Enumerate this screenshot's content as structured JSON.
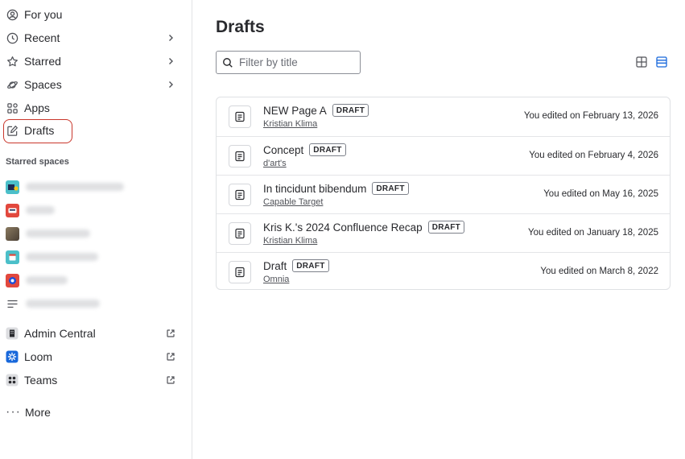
{
  "sidebar": {
    "nav": [
      {
        "label": "For you",
        "icon": "person-circle-icon"
      },
      {
        "label": "Recent",
        "icon": "clock-icon"
      },
      {
        "label": "Starred",
        "icon": "star-icon"
      },
      {
        "label": "Spaces",
        "icon": "planet-icon"
      },
      {
        "label": "Apps",
        "icon": "apps-icon"
      },
      {
        "label": "Drafts",
        "icon": "edit-icon"
      }
    ],
    "starred_header": "Starred spaces",
    "starred_spaces": [
      {
        "avatar_color": "#4bbfc9"
      },
      {
        "avatar_color": "#e2483d"
      },
      {
        "avatar_color": "#6b5a4a"
      },
      {
        "avatar_color": "#4bbfc9"
      },
      {
        "avatar_color": "#e2483d"
      },
      {
        "avatar_color": "#ffffff"
      }
    ],
    "external_links": [
      {
        "label": "Admin Central",
        "icon": "building-icon"
      },
      {
        "label": "Loom",
        "icon": "loom-icon"
      },
      {
        "label": "Teams",
        "icon": "teams-icon"
      }
    ],
    "more_label": "More"
  },
  "main": {
    "title": "Drafts",
    "filter_placeholder": "Filter by title",
    "drafts": [
      {
        "title": "NEW Page A",
        "status": "DRAFT",
        "space": "Kristian Klima",
        "edited": "You edited on February 13, 2026"
      },
      {
        "title": "Concept",
        "status": "DRAFT",
        "space": "d'art's",
        "edited": "You edited on February 4, 2026"
      },
      {
        "title": "In tincidunt bibendum",
        "status": "DRAFT",
        "space": "Capable Target",
        "edited": "You edited on May 16, 2025"
      },
      {
        "title": "Kris K.'s 2024 Confluence Recap",
        "status": "DRAFT",
        "space": "Kristian Klima",
        "edited": "You edited on January 18, 2025"
      },
      {
        "title": "Draft",
        "status": "DRAFT",
        "space": "Omnia",
        "edited": "You edited on March 8, 2022"
      }
    ]
  },
  "colors": {
    "accent": "#1868db",
    "highlight_ring": "#c9372c"
  }
}
